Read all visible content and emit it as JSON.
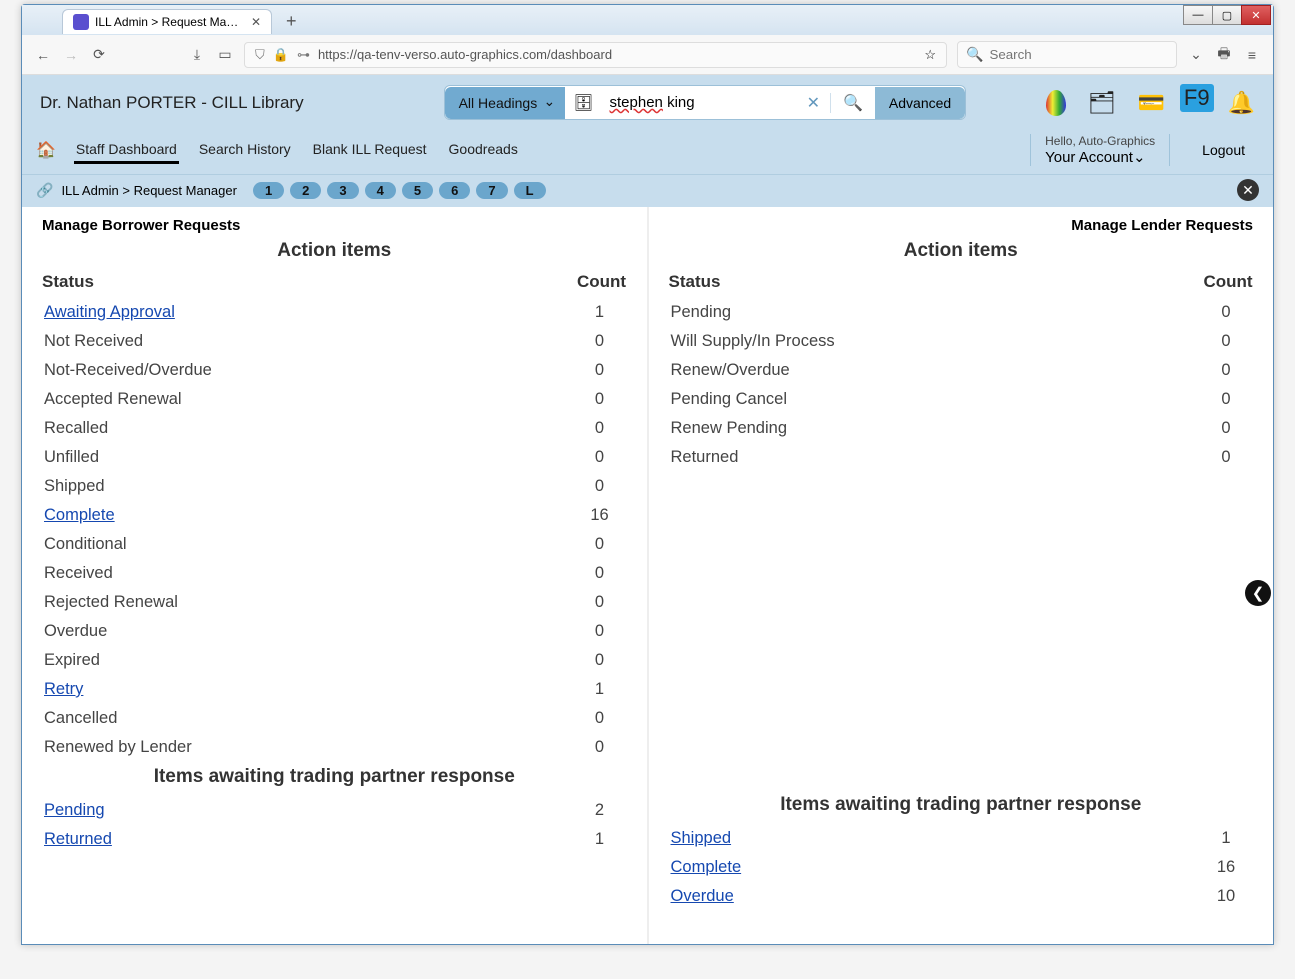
{
  "browser": {
    "tab_title": "ILL Admin > Request Manager |",
    "url": "https://qa-tenv-verso.auto-graphics.com/dashboard",
    "search_placeholder": "Search"
  },
  "header": {
    "user_label": "Dr. Nathan PORTER - CILL Library",
    "heading_dropdown": "All Headings",
    "search_value": "stephen king",
    "search_spell_part": "stephen",
    "search_rest": " king",
    "advanced": "Advanced",
    "hello": "Hello, Auto-Graphics",
    "account": "Your Account",
    "logout": "Logout",
    "fav_badge": "F9"
  },
  "nav": {
    "items": [
      "Staff Dashboard",
      "Search History",
      "Blank ILL Request",
      "Goodreads"
    ],
    "active_index": 0
  },
  "breadcrumb": {
    "text": "ILL Admin  >  Request Manager",
    "pages": [
      "1",
      "2",
      "3",
      "4",
      "5",
      "6",
      "7",
      "L"
    ]
  },
  "borrower": {
    "title": "Manage Borrower Requests",
    "action_header": "Action items",
    "status_label": "Status",
    "count_label": "Count",
    "rows": [
      {
        "status": "Awaiting Approval",
        "count": 1,
        "link": true
      },
      {
        "status": "Not Received",
        "count": 0
      },
      {
        "status": "Not-Received/Overdue",
        "count": 0
      },
      {
        "status": "Accepted Renewal",
        "count": 0
      },
      {
        "status": "Recalled",
        "count": 0
      },
      {
        "status": "Unfilled",
        "count": 0
      },
      {
        "status": "Shipped",
        "count": 0
      },
      {
        "status": "Complete",
        "count": 16,
        "link": true
      },
      {
        "status": "Conditional",
        "count": 0
      },
      {
        "status": "Received",
        "count": 0
      },
      {
        "status": "Rejected Renewal",
        "count": 0
      },
      {
        "status": "Overdue",
        "count": 0
      },
      {
        "status": "Expired",
        "count": 0
      },
      {
        "status": "Retry",
        "count": 1,
        "link": true
      },
      {
        "status": "Cancelled",
        "count": 0
      },
      {
        "status": "Renewed by Lender",
        "count": 0
      }
    ],
    "awaiting_header": "Items awaiting trading partner response",
    "awaiting_rows": [
      {
        "status": "Pending",
        "count": 2,
        "link": true
      },
      {
        "status": "Returned",
        "count": 1,
        "link": true
      }
    ]
  },
  "lender": {
    "title": "Manage Lender Requests",
    "action_header": "Action items",
    "status_label": "Status",
    "count_label": "Count",
    "rows": [
      {
        "status": "Pending",
        "count": 0
      },
      {
        "status": "Will Supply/In Process",
        "count": 0
      },
      {
        "status": "Renew/Overdue",
        "count": 0
      },
      {
        "status": "Pending Cancel",
        "count": 0
      },
      {
        "status": "Renew Pending",
        "count": 0
      },
      {
        "status": "Returned",
        "count": 0
      }
    ],
    "awaiting_header": "Items awaiting trading partner response",
    "awaiting_rows": [
      {
        "status": "Shipped",
        "count": 1,
        "link": true
      },
      {
        "status": "Complete",
        "count": 16,
        "link": true
      },
      {
        "status": "Overdue",
        "count": 10,
        "link": true
      }
    ]
  }
}
